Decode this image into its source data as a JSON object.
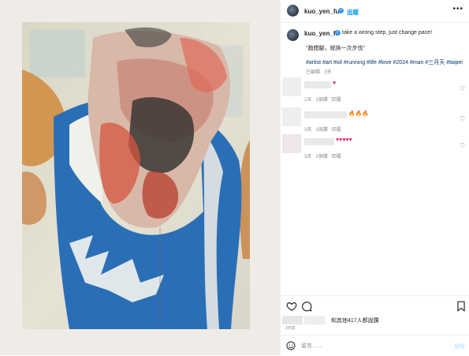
{
  "header": {
    "username": "kuo_yen_fu",
    "follow_label": "追蹤",
    "more_label": "•••"
  },
  "caption": {
    "username": "kuo_yen_fu",
    "line1": "take a wrong step, just change pace!",
    "line2": "\"跑錯腳，就換一次步伐\"",
    "hashtags": "#artist #art #oil #running #life #love #2024 #man #三月天 #taipei",
    "meta": "已編輯 · 3天"
  },
  "comments": [
    {
      "emoji": "♥",
      "time": "2天",
      "likes": "1個讚",
      "reply": "回覆"
    },
    {
      "emoji": "🔥🔥🔥",
      "time": "3天",
      "likes": "1個讚",
      "reply": "回覆"
    },
    {
      "emoji": "♥♥♥♥♥",
      "time": "3天",
      "likes": "1個讚",
      "reply": "回覆"
    }
  ],
  "likes": {
    "text": "和其他417人都說讚",
    "date": "3天前"
  },
  "compose": {
    "placeholder": "留言……"
  },
  "icons": {
    "like": "heart-icon",
    "comment": "comment-icon",
    "save": "bookmark-icon",
    "emoji": "smiley-icon",
    "verified": "verified-badge-icon"
  },
  "colors": {
    "accent": "#0095f6",
    "background": "#efebe6",
    "link": "#00376b"
  }
}
